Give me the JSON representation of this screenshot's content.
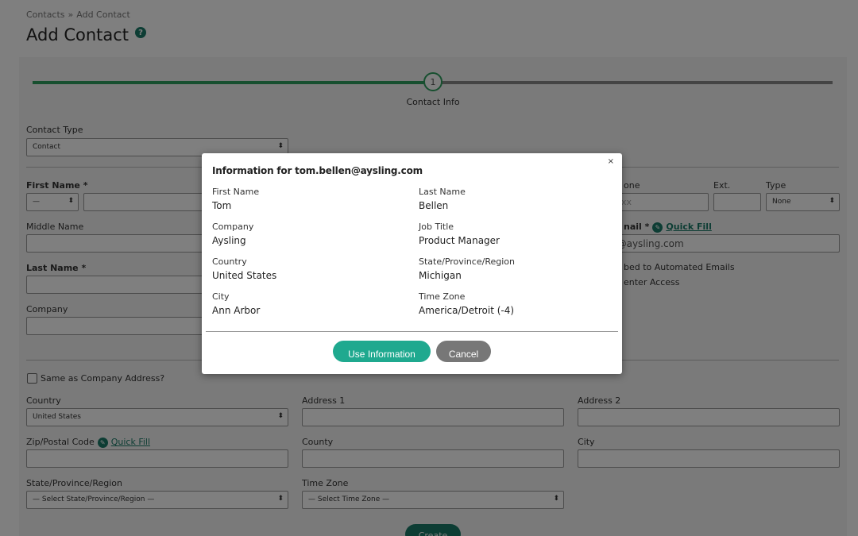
{
  "breadcrumb": {
    "parent": "Contacts",
    "separator": "»",
    "current": "Add Contact"
  },
  "page": {
    "title": "Add Contact",
    "help_icon": "?"
  },
  "progress": {
    "step_number": "1",
    "step_label": "Contact Info",
    "fraction": 0.49
  },
  "form": {
    "contact_type_label": "Contact Type",
    "contact_type_value": "Contact",
    "first_name_label": "First Name *",
    "prefix_value": "—",
    "middle_name_label": "Middle Name",
    "last_name_label": "Last Name *",
    "company_label": "Company",
    "phone_label": "one",
    "phone_placeholder": "xxxx",
    "ext_label": "Ext.",
    "type_label": "Type",
    "type_value": "None",
    "email_label": "nail *",
    "email_quick_fill": "Quick Fill",
    "email_value": "n@aysling.com",
    "subscribed_text": "bed to Automated Emails",
    "center_access_text": "enter Access",
    "same_as_company_label": "Same as Company Address?",
    "country_label": "Country",
    "country_value": "United States",
    "address1_label": "Address 1",
    "address2_label": "Address 2",
    "zip_label": "Zip/Postal Code",
    "zip_quick_fill": "Quick Fill",
    "county_label": "County",
    "city_label": "City",
    "state_label": "State/Province/Region",
    "state_value": "— Select State/Province/Region —",
    "timezone_label": "Time Zone",
    "timezone_value": "— Select Time Zone —",
    "create_button": "Create"
  },
  "modal": {
    "close": "×",
    "title": "Information for tom.bellen@aysling.com",
    "fields": [
      {
        "label": "First Name",
        "value": "Tom"
      },
      {
        "label": "Last Name",
        "value": "Bellen"
      },
      {
        "label": "Company",
        "value": "Aysling"
      },
      {
        "label": "Job Title",
        "value": "Product Manager"
      },
      {
        "label": "Country",
        "value": "United States"
      },
      {
        "label": "State/Province/Region",
        "value": "Michigan"
      },
      {
        "label": "City",
        "value": "Ann Arbor"
      },
      {
        "label": "Time Zone",
        "value": "America/Detroit (-4)"
      }
    ],
    "use_button": "Use Information",
    "cancel_button": "Cancel"
  },
  "colors": {
    "accent": "#1fa98f",
    "brand_dark": "#1a7a68",
    "progress": "#2e9e5e",
    "cancel": "#777777"
  }
}
